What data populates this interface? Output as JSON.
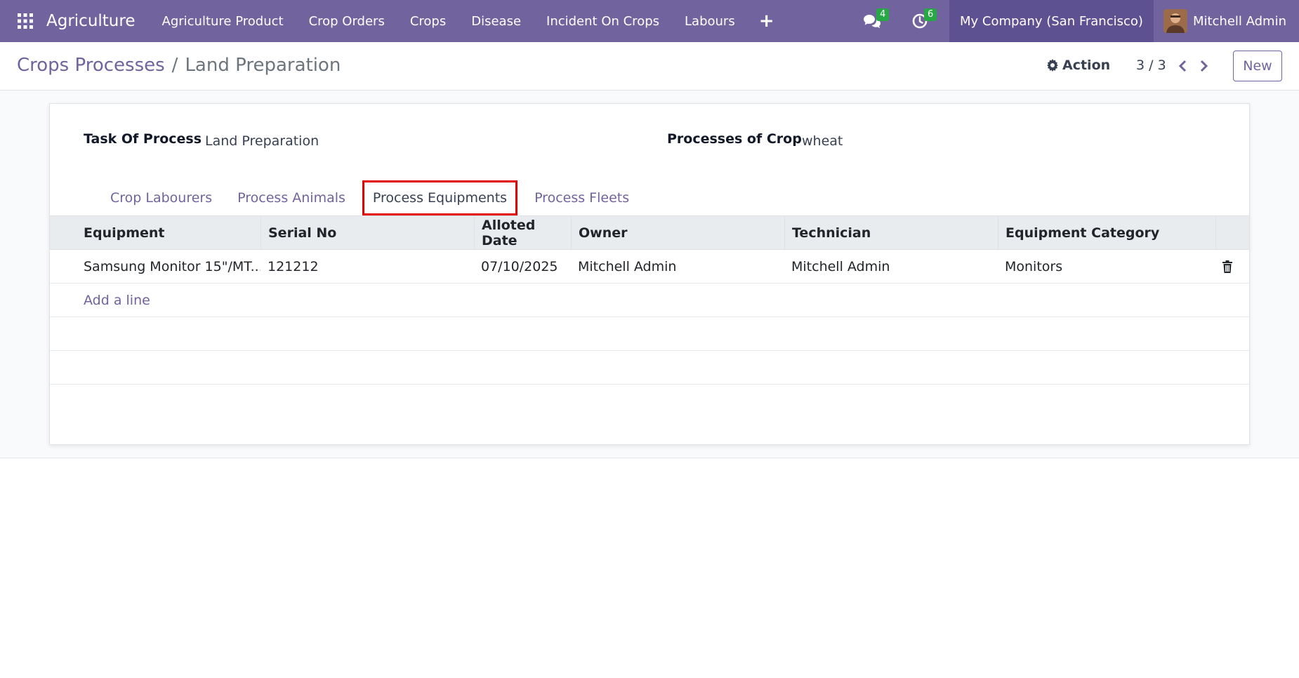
{
  "navbar": {
    "brand": "Agriculture",
    "menu": [
      "Agriculture Product",
      "Crop Orders",
      "Crops",
      "Disease",
      "Incident On Crops",
      "Labours"
    ],
    "messages_badge": "4",
    "activities_badge": "6",
    "company": "My Company (San Francisco)",
    "user": "Mitchell Admin"
  },
  "breadcrumb": {
    "parent": "Crops Processes",
    "separator": "/",
    "current": "Land Preparation"
  },
  "toolbar": {
    "action_label": "Action",
    "pager": "3 / 3",
    "new_label": "New"
  },
  "form": {
    "task_label": "Task Of Process",
    "task_value": "Land Preparation",
    "crop_label": "Processes of Crop",
    "crop_value": "wheat"
  },
  "tabs": [
    "Crop Labourers",
    "Process Animals",
    "Process Equipments",
    "Process Fleets"
  ],
  "active_tab": "Process Equipments",
  "table": {
    "columns": [
      "Equipment",
      "Serial No",
      "Alloted Date",
      "Owner",
      "Technician",
      "Equipment Category"
    ],
    "rows": [
      [
        "Samsung Monitor 15\"/MT...",
        "121212",
        "07/10/2025",
        "Mitchell Admin",
        "Mitchell Admin",
        "Monitors"
      ]
    ],
    "add_line": "Add a line"
  },
  "colors": {
    "brand": "#71639e",
    "highlight": "#e00000",
    "badge": "#28a745"
  }
}
